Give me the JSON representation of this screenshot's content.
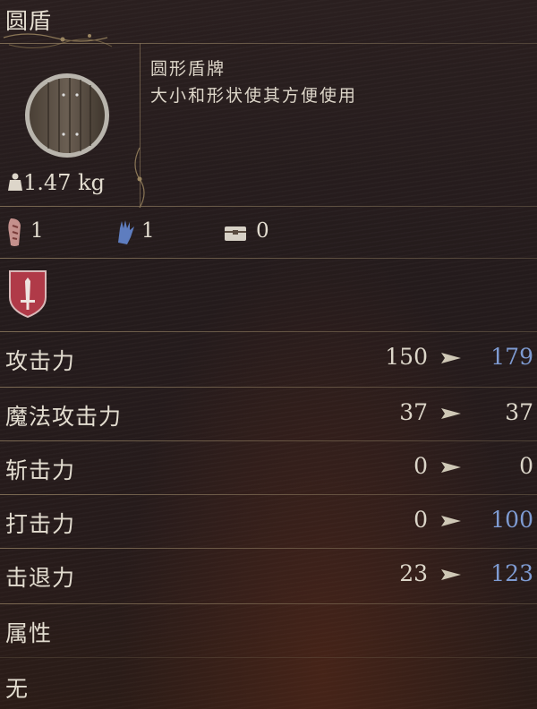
{
  "item": {
    "name": "圆盾",
    "type_line": "圆形盾牌",
    "description": "大小和形状使其方便使用",
    "weight": "1.47 kg"
  },
  "requirements": [
    {
      "icon": "strength-fist-icon",
      "value": "1"
    },
    {
      "icon": "magic-hand-icon",
      "value": "1"
    },
    {
      "icon": "chest-icon",
      "value": "0"
    }
  ],
  "stats": [
    {
      "label": "攻击力",
      "base": "150",
      "new": "179",
      "changed": true
    },
    {
      "label": "魔法攻击力",
      "base": "37",
      "new": "37",
      "changed": false
    },
    {
      "label": "斩击力",
      "base": "0",
      "new": "0",
      "changed": false
    },
    {
      "label": "打击力",
      "base": "0",
      "new": "100",
      "changed": true
    },
    {
      "label": "击退力",
      "base": "23",
      "new": "123",
      "changed": true
    }
  ],
  "attribute": {
    "heading": "属性",
    "value": "无"
  },
  "colors": {
    "increased": "#7e9bd2",
    "text": "#e3ddd0",
    "badge": "#b03a48"
  }
}
